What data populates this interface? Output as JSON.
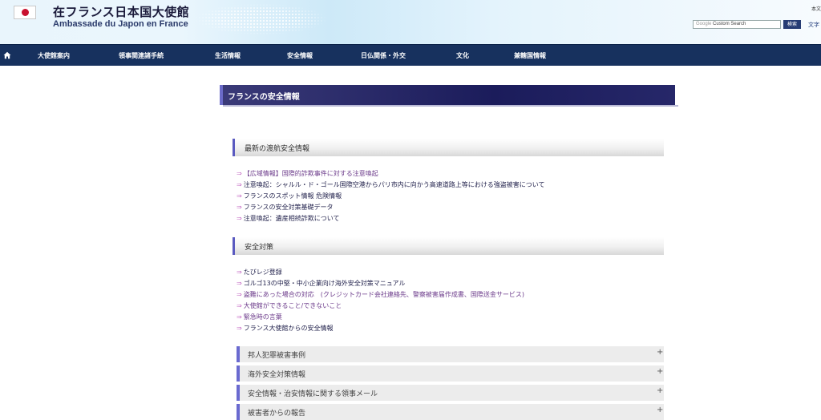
{
  "header": {
    "title_jp": "在フランス日本国大使館",
    "title_fr": "Ambassade du Japon en France",
    "top_right_text": "本文",
    "search_placeholder_brand": "Google",
    "search_placeholder": "Custom Search",
    "search_button": "検索",
    "font_size_label": "文字"
  },
  "nav": {
    "items": [
      "大使館案内",
      "領事関連諸手続",
      "生活情報",
      "安全情報",
      "日仏関係・外交",
      "文化",
      "兼轄国情報"
    ]
  },
  "page": {
    "title": "フランスの安全情報"
  },
  "sections": [
    {
      "heading": "最新の渡航安全情報",
      "links": [
        "【広域情報】国際的詐欺事件に対する注意喚起",
        "注意喚起：シャルル・ド・ゴール国際空港からパリ市内に向かう高速道路上等における強盗被害について",
        "フランスのスポット情報 危険情報",
        "フランスの安全対策基礎データ",
        "注意喚起：遺産相続詐欺について"
      ]
    },
    {
      "heading": "安全対策",
      "links": [
        "たびレジ登録",
        "ゴルゴ13の中堅・中小企業向け海外安全対策マニュアル",
        "盗難にあった場合の対応　(クレジットカード会社連絡先、警察被害届作成書、国際送金サービス)",
        "大使館ができること/できないこと",
        "緊急時の言葉",
        "フランス大使館からの安全情報"
      ]
    }
  ],
  "accordions": [
    {
      "label": "邦人犯罪被害事例",
      "symbol": "+"
    },
    {
      "label": "海外安全対策情報",
      "symbol": "+"
    },
    {
      "label": "安全情報・治安情報に関する領事メール",
      "symbol": "+"
    },
    {
      "label": "被害者からの報告",
      "symbol": "+"
    }
  ],
  "icons": {
    "home": "home-icon",
    "link_arrow": "⇒"
  },
  "colors": {
    "nav_bg": "#17315e",
    "title_bar": "#1b1c5b",
    "accent": "#6a6ad0"
  }
}
